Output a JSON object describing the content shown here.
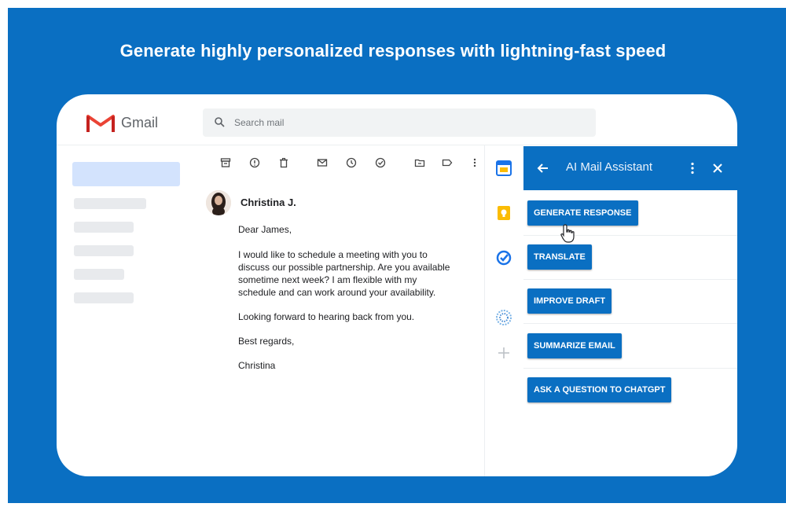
{
  "headline": "Generate highly personalized responses with lightning-fast speed",
  "gmail": {
    "app_name": "Gmail",
    "search_placeholder": "Search mail"
  },
  "email": {
    "sender": "Christina J.",
    "body_lines": [
      "Dear James,",
      "I would like to schedule a meeting with you to",
      "discuss our possible partnership. Are you available",
      "sometime next week? I am flexible with my",
      "schedule and can work around your availability.",
      "Looking forward to hearing back from you.",
      "Best regards,",
      "Christina"
    ]
  },
  "assistant": {
    "title": "AI Mail Assistant",
    "buttons": [
      "GENERATE RESPONSE",
      "TRANSLATE",
      "IMPROVE DRAFT",
      "SUMMARIZE EMAIL",
      "ASK A QUESTION TO CHATGPT"
    ]
  },
  "colors": {
    "brand_blue": "#0a6fc2",
    "gmail_red": "#ea4335"
  },
  "icons": {
    "toolbar": [
      "archive-icon",
      "report-spam-icon",
      "delete-icon",
      "mark-unread-icon",
      "snooze-icon",
      "add-task-icon",
      "move-to-icon",
      "label-icon",
      "more-vert-icon"
    ],
    "side": [
      "calendar-icon",
      "keep-icon",
      "tasks-icon",
      "assistant-addon-icon",
      "add-icon"
    ]
  }
}
